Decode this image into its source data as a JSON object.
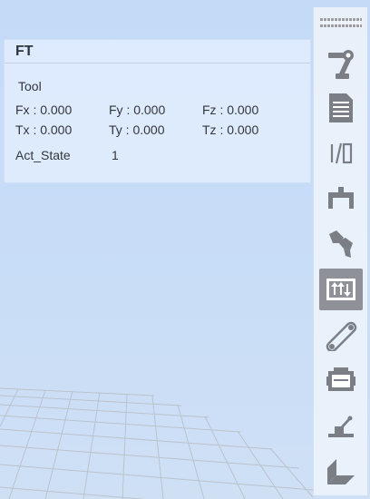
{
  "ft_panel": {
    "title": "FT",
    "frame_label": "Tool",
    "fx": "Fx : 0.000",
    "fy": "Fy : 0.000",
    "fz": "Fz : 0.000",
    "tx": "Tx : 0.000",
    "ty": "Ty : 0.000",
    "tz": "Tz : 0.000",
    "act_state_label": "Act_State",
    "act_state_value": "1"
  },
  "toolbar": {
    "items": [
      {
        "icon": "robot-arm-icon"
      },
      {
        "icon": "document-icon"
      },
      {
        "icon": "io-icon"
      },
      {
        "icon": "gripper-icon"
      },
      {
        "icon": "pick-tool-icon"
      },
      {
        "icon": "force-torque-icon",
        "active": true
      },
      {
        "icon": "conveyor-icon"
      },
      {
        "icon": "controller-box-icon"
      },
      {
        "icon": "joystick-icon"
      },
      {
        "icon": "workspace-plane-icon"
      }
    ]
  },
  "colors": {
    "background": "#c4dbf8",
    "panel": "#dfecfd",
    "toolbar": "#eceff6",
    "active_button": "#8e9298",
    "icon": "#7b7f85"
  }
}
